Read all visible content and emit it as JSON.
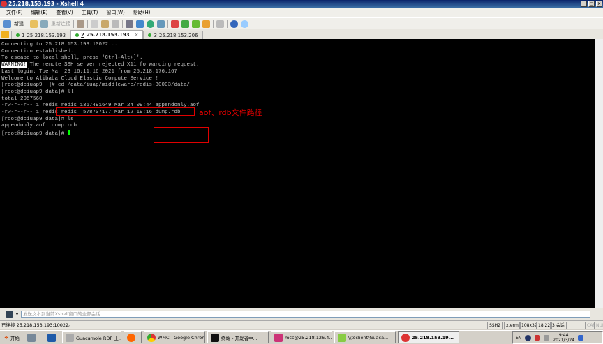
{
  "window": {
    "title": "25.218.153.193 - Xshell 4"
  },
  "menu": [
    "文件(F)",
    "编辑(E)",
    "查看(V)",
    "工具(T)",
    "窗口(W)",
    "帮助(H)"
  ],
  "toolbar": {
    "new_label": "新建",
    "reconnect_label": "重新连接"
  },
  "tabs": [
    {
      "num": "1",
      "label": "25.218.153.193"
    },
    {
      "num": "2",
      "label": "25.218.153.193",
      "close": "×"
    },
    {
      "num": "3",
      "label": "25.218.153.206"
    }
  ],
  "terminal": {
    "lines": [
      "",
      "Connecting to 25.218.153.193:10022...",
      "Connection established.",
      "To escape to local shell, press 'Ctrl+Alt+]'.",
      ""
    ],
    "warning_tag": "WARNING!",
    "warning_text": " The remote SSH server rejected X11 forwarding request.",
    "lines2": [
      "Last login: Tue Mar 23 16:11:16 2021 from 25.218.176.167",
      "",
      "Welcome to Alibaba Cloud Elastic Compute Service !",
      ""
    ],
    "prompt1": "[root@dciuap9 ~]# ",
    "cmd1": "cd /data/iuap/middleware/redis-30003/data/",
    "lines3": [
      "[root@dciuap9 data]# ll",
      "total 2057560",
      "-rw-r--r-- 1 redis redis 1367491649 Mar 24 09:44 appendonly.aof",
      "-rw-r--r-- 1 redis redis  578707177 Mar 12 19:16 dump.rdb",
      "[root@dciuap9 data]# ls",
      "appendonly.aof  dump.rdb"
    ],
    "prompt_last": "[root@dciuap9 data]# ",
    "annotation": "aof、rdb文件路径"
  },
  "send_input": {
    "placeholder": "发送文本到当前Xshell窗口的全部会话"
  },
  "status": {
    "connected": "已连接 25.218.153.193:10022。",
    "protocol": "SSH2",
    "term": "xterm",
    "size": "108x39",
    "pos": "18,22",
    "sessions": "3 会话",
    "cap": "CAP",
    "num": "NUM"
  },
  "taskbar": {
    "start": "开始",
    "items": [
      "Guacamole RDP 上...",
      "WMC - Google Chrome",
      "终端 - 开发者中...",
      "mcc@25.218.126.4...",
      "\\\\tsclient\\Guaca...",
      "25.218.153.19..."
    ],
    "lang": "EN",
    "time": "9:44",
    "date": "2021/3/24"
  }
}
